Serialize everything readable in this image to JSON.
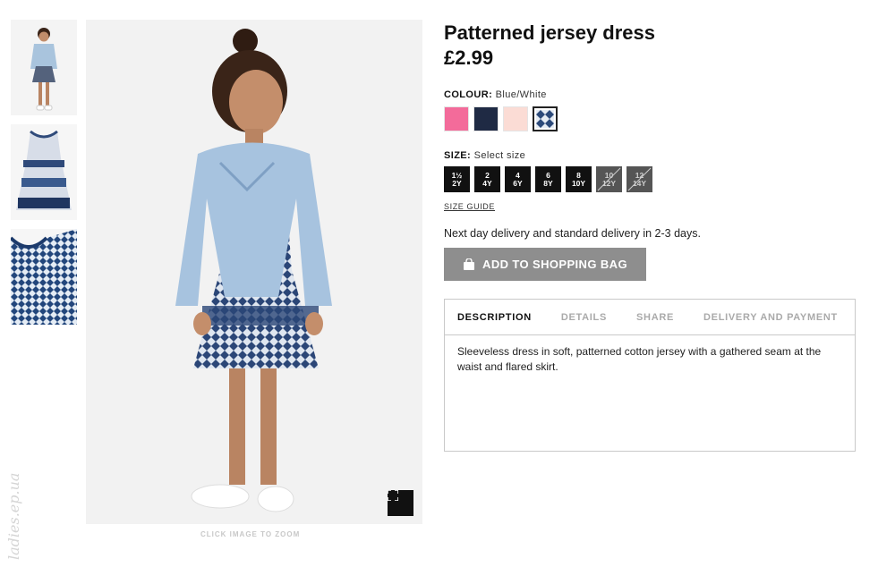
{
  "product": {
    "title": "Patterned jersey dress",
    "price": "£2.99"
  },
  "colour": {
    "label": "COLOUR:",
    "value": "Blue/White",
    "swatches": [
      {
        "name": "Pink",
        "color": "#f36b9a"
      },
      {
        "name": "Dark blue",
        "color": "#1f2a44"
      },
      {
        "name": "Light pink",
        "color": "#fbdcd5"
      },
      {
        "name": "Blue/White",
        "color": "#2c4a7a",
        "selected": true
      }
    ]
  },
  "size": {
    "label": "SIZE:",
    "value": "Select size",
    "options": [
      {
        "top": "1½",
        "bottom": "2Y",
        "available": true
      },
      {
        "top": "2",
        "bottom": "4Y",
        "available": true
      },
      {
        "top": "4",
        "bottom": "6Y",
        "available": true
      },
      {
        "top": "6",
        "bottom": "8Y",
        "available": true
      },
      {
        "top": "8",
        "bottom": "10Y",
        "available": true
      },
      {
        "top": "10",
        "bottom": "12Y",
        "available": false
      },
      {
        "top": "12",
        "bottom": "14Y",
        "available": false
      }
    ],
    "guide_label": "SIZE GUIDE"
  },
  "delivery_text": "Next day delivery and standard delivery in 2-3 days.",
  "add_to_bag_label": "ADD TO SHOPPING BAG",
  "tabs": [
    {
      "label": "DESCRIPTION",
      "active": true
    },
    {
      "label": "DETAILS",
      "active": false
    },
    {
      "label": "SHARE",
      "active": false
    },
    {
      "label": "DELIVERY AND PAYMENT",
      "active": false
    }
  ],
  "description": "Sleeveless dress in soft, patterned cotton jersey with a gathered seam at the waist and flared skirt.",
  "zoom_hint": "CLICK IMAGE TO ZOOM",
  "watermark": "ladies.ep.ua",
  "icons": {
    "zoom": "fullscreen-icon",
    "bag": "shopping-bag-icon"
  }
}
